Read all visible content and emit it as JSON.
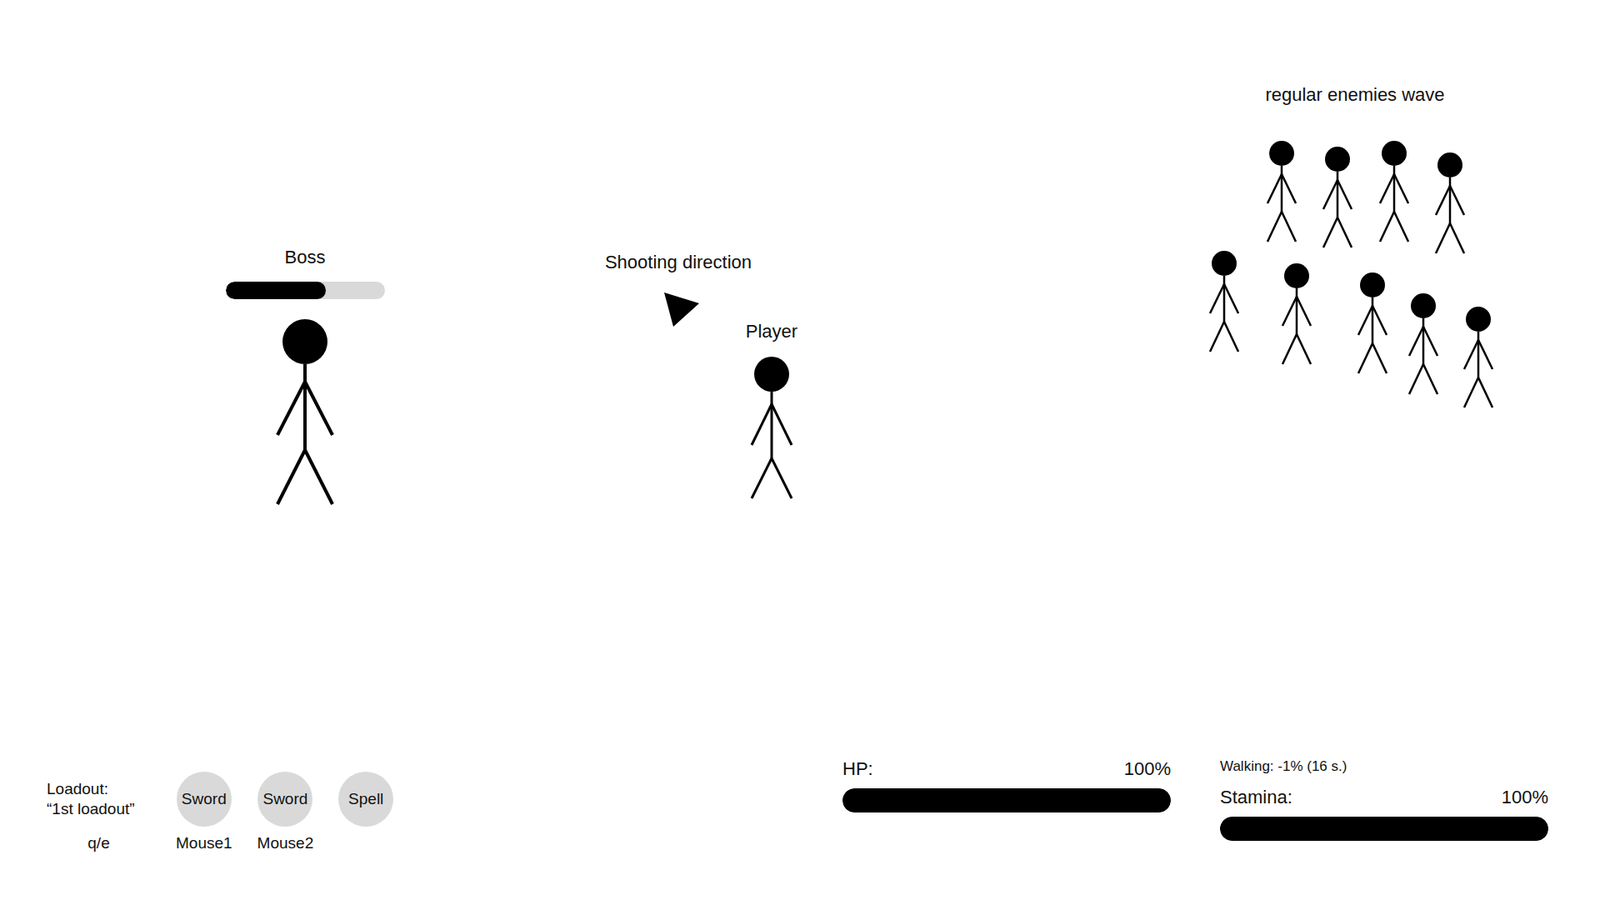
{
  "boss": {
    "label": "Boss",
    "health": 0.63
  },
  "shooting_direction": {
    "label": "Shooting direction"
  },
  "player": {
    "label": "Player"
  },
  "enemy_wave": {
    "label": "regular enemies wave",
    "enemies": [
      {},
      {},
      {},
      {},
      {},
      {},
      {},
      {},
      {}
    ]
  },
  "loadout": {
    "label": "Loadout:",
    "name": "“1st loadout”",
    "switch_key": "q/e",
    "slots": [
      {
        "label": "Sword",
        "key": "Mouse1"
      },
      {
        "label": "Sword",
        "key": "Mouse2"
      },
      {
        "label": "Spell",
        "key": ""
      }
    ]
  },
  "hp": {
    "label": "HP:",
    "value": "100%",
    "level": 1
  },
  "stamina": {
    "label": "Stamina:",
    "value": "100%",
    "level": 1,
    "effect": "Walking: -1% (16 s.)"
  }
}
